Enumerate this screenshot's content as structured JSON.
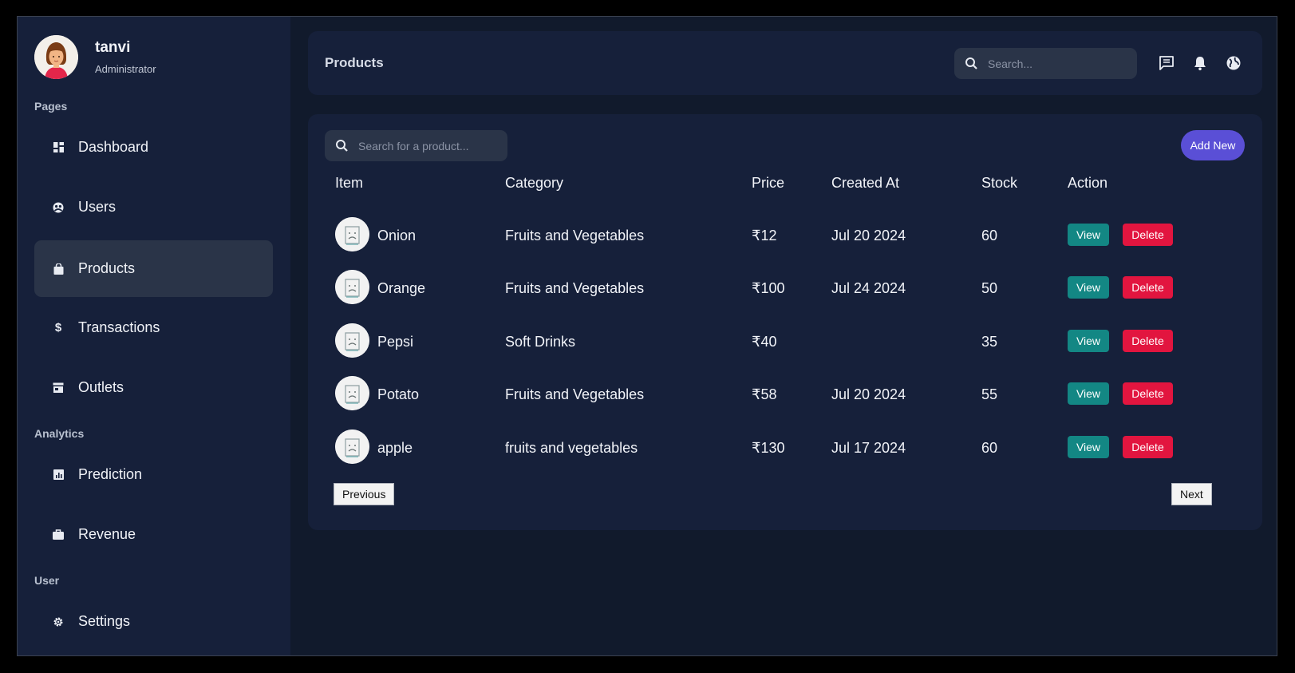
{
  "user": {
    "name": "tanvi",
    "role": "Administrator"
  },
  "sidebar": {
    "sections": [
      "Pages",
      "Analytics",
      "User"
    ],
    "items": [
      {
        "label": "Dashboard",
        "icon": "dashboard-icon"
      },
      {
        "label": "Users",
        "icon": "users-icon"
      },
      {
        "label": "Products",
        "icon": "shopping-bag-icon",
        "active": true
      },
      {
        "label": "Transactions",
        "icon": "dollar-icon"
      },
      {
        "label": "Outlets",
        "icon": "store-icon"
      },
      {
        "label": "Prediction",
        "icon": "chart-icon"
      },
      {
        "label": "Revenue",
        "icon": "briefcase-icon"
      },
      {
        "label": "Settings",
        "icon": "gear-icon"
      }
    ]
  },
  "header": {
    "title": "Products",
    "search_placeholder": "Search...",
    "icons": [
      "message-icon",
      "bell-icon",
      "globe-icon"
    ]
  },
  "products": {
    "search_placeholder": "Search for a product...",
    "add_label": "Add New",
    "columns": [
      "Item",
      "Category",
      "Price",
      "Created At",
      "Stock",
      "Action"
    ],
    "rows": [
      {
        "item": "Onion",
        "category": "Fruits and Vegetables",
        "price": "₹12",
        "created": "Jul 20 2024",
        "stock": "60"
      },
      {
        "item": "Orange",
        "category": "Fruits and Vegetables",
        "price": "₹100",
        "created": "Jul 24 2024",
        "stock": "50"
      },
      {
        "item": "Pepsi",
        "category": "Soft Drinks",
        "price": "₹40",
        "created": "",
        "stock": "35"
      },
      {
        "item": "Potato",
        "category": "Fruits and Vegetables",
        "price": "₹58",
        "created": "Jul 20 2024",
        "stock": "55"
      },
      {
        "item": "apple",
        "category": "fruits and vegetables",
        "price": "₹130",
        "created": "Jul 17 2024",
        "stock": "60"
      }
    ],
    "view_label": "View",
    "delete_label": "Delete",
    "previous_label": "Previous",
    "next_label": "Next"
  },
  "colors": {
    "background": "#111a2c",
    "panel": "#16203a",
    "accent": "#5a4fd6",
    "view": "#138784",
    "delete": "#e2153f"
  }
}
